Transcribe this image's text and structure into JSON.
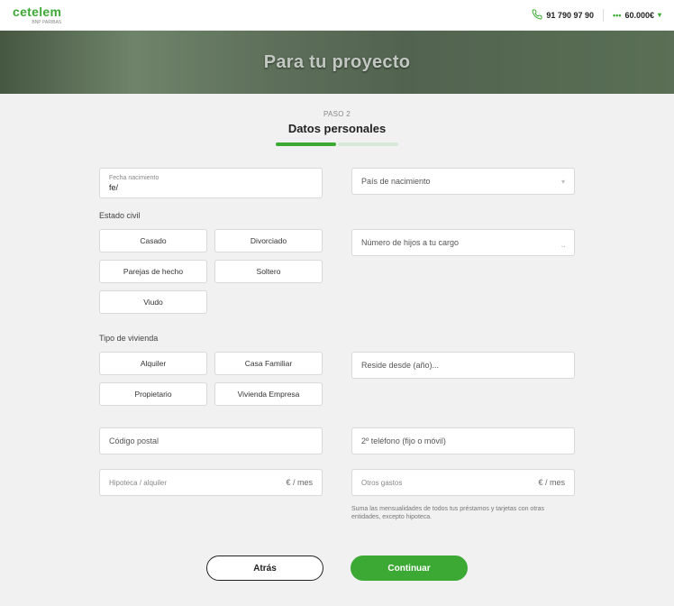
{
  "header": {
    "logo": "cetelem",
    "logo_sub": "BNP PARIBAS",
    "phone": "91 790 97 90",
    "amount": "60.000€"
  },
  "hero": {
    "title": "Para tu proyecto"
  },
  "step": {
    "label": "PASO 2",
    "title": "Datos personales"
  },
  "fields": {
    "fecha_label": "Fecha nacimiento",
    "fecha_value": "fe/",
    "pais_label": "País de nacimiento",
    "estado_civil_label": "Estado civil",
    "estado_civil_options": [
      "Casado",
      "Divorciado",
      "Parejas de hecho",
      "Soltero",
      "Viudo"
    ],
    "num_hijos_placeholder": "Número de hijos a tu cargo",
    "tipo_vivienda_label": "Tipo de vivienda",
    "tipo_vivienda_options": [
      "Alquiler",
      "Casa Familiar",
      "Propietario",
      "Vivienda Empresa"
    ],
    "reside_desde_placeholder": "Reside desde (año)...",
    "codigo_postal_placeholder": "Código postal",
    "telefono2_placeholder": "2º teléfono (fijo o móvil)",
    "hipoteca_label": "Hipoteca / alquiler",
    "otros_gastos_label": "Otros gastos",
    "euro_suffix": "€ / mes",
    "gastos_helper": "Suma las mensualidades de todos tus préstamos y tarjetas con otras entidades, excepto hipoteca."
  },
  "buttons": {
    "back": "Atrás",
    "next": "Continuar"
  }
}
